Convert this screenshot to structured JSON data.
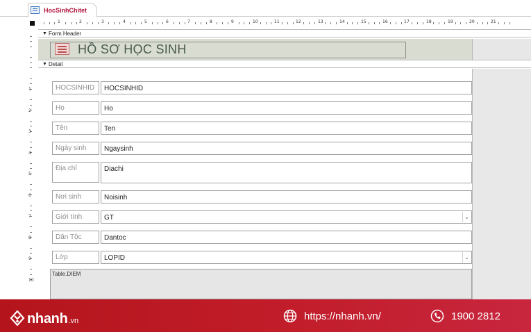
{
  "tab": {
    "label": "HocSinhChitet",
    "icon": "form-icon"
  },
  "ruler": {
    "horizontal": [
      "1",
      "2",
      "3",
      "4",
      "5",
      "6",
      "7",
      "8",
      "9",
      "10",
      "11",
      "12",
      "13",
      "14",
      "15",
      "16",
      "17",
      "18",
      "19",
      "20",
      "21"
    ],
    "vertical": [
      "1",
      "2",
      "3",
      "4",
      "5",
      "6",
      "7",
      "8",
      "9",
      "10"
    ]
  },
  "sections": {
    "form_header": "Form Header",
    "detail": "Detail"
  },
  "header": {
    "title": "HỒ SƠ HỌC SINH",
    "icon": "form-icon"
  },
  "fields": [
    {
      "label": "HOCSINHID",
      "control": "HOCSINHID",
      "type": "text"
    },
    {
      "label": "Họ",
      "control": "Ho",
      "type": "text"
    },
    {
      "label": "Tên",
      "control": "Ten",
      "type": "text"
    },
    {
      "label": "Ngày sinh",
      "control": "Ngaysinh",
      "type": "text"
    },
    {
      "label": "Địa chỉ",
      "control": "Diachi",
      "type": "text"
    },
    {
      "label": "Nơi sinh",
      "control": "Noisinh",
      "type": "text"
    },
    {
      "label": "Giới tính",
      "control": "GT",
      "type": "combo"
    },
    {
      "label": "Dân Tộc",
      "control": "Dantoc",
      "type": "text"
    },
    {
      "label": "Lớp",
      "control": "LOPID",
      "type": "combo"
    }
  ],
  "subform": {
    "label": "Table.DIEM"
  },
  "banner": {
    "brand": "nhanh",
    "brand_tld": ".vn",
    "website": "https://nhanh.vn/",
    "phone": "1900 2812",
    "colors": {
      "background": "#c11d2a",
      "text": "#ffffff"
    }
  },
  "colors": {
    "tab_label": "#b0123a",
    "header_band": "#d9ddd1",
    "label_text": "#8e8e8e"
  }
}
